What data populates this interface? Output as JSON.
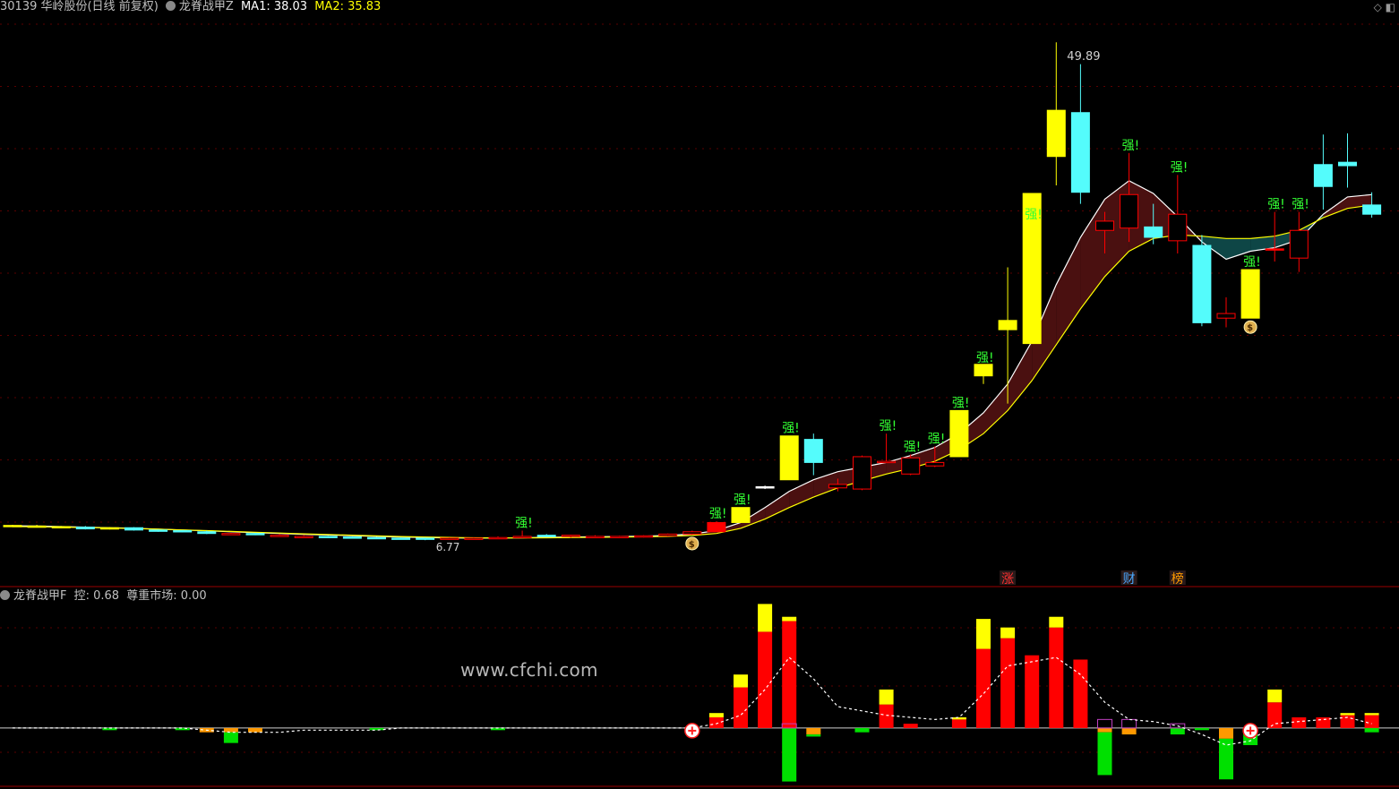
{
  "header": {
    "stock": "30139 华岭股份(日线 前复权)",
    "indicator": "龙脊战甲Z",
    "ma1_label": "MA1: 38.03",
    "ma2_label": "MA2: 35.83"
  },
  "sub_header": {
    "indicator": "龙脊战甲F",
    "ctrl_label": "控: 0.68",
    "respect_label": "尊重市场: 0.00"
  },
  "watermark": "www.cfchi.com",
  "colors": {
    "background": "#000000",
    "yang_yellow": "#ffff00",
    "yin_cyan": "#54fcfc",
    "red": "#ff0000",
    "green": "#00e000",
    "orange": "#ff9900",
    "ribbon_up": "#4a1010",
    "ribbon_down": "#0e4646"
  },
  "chart_data": [
    {
      "type": "candlestick",
      "price_range": [
        5.0,
        52.0
      ],
      "high_label": "49.89",
      "low_label": "6.77",
      "strong_label": "强!",
      "x_index": [
        0,
        1,
        2,
        3,
        4,
        5,
        6,
        7,
        8,
        9,
        10,
        11,
        12,
        13,
        14,
        15,
        16,
        17,
        18,
        19,
        20,
        21,
        22,
        23,
        24,
        25,
        26,
        27,
        28,
        29,
        30,
        31,
        32,
        33,
        34,
        35,
        36,
        37,
        38,
        39,
        40,
        41,
        42,
        43,
        44,
        45,
        46,
        47,
        48,
        49,
        50,
        51,
        52,
        53,
        54,
        55,
        56
      ],
      "candles": [
        {
          "o": 8.0,
          "h": 8.1,
          "l": 7.9,
          "c": 8.05,
          "k": "y"
        },
        {
          "o": 8.0,
          "h": 8.1,
          "l": 7.9,
          "c": 8.0,
          "k": "y"
        },
        {
          "o": 7.95,
          "h": 8.0,
          "l": 7.8,
          "c": 7.9,
          "k": "y"
        },
        {
          "o": 7.9,
          "h": 8.0,
          "l": 7.7,
          "c": 7.75,
          "k": "c"
        },
        {
          "o": 7.75,
          "h": 7.9,
          "l": 7.7,
          "c": 7.85,
          "k": "y"
        },
        {
          "o": 7.85,
          "h": 7.9,
          "l": 7.6,
          "c": 7.65,
          "k": "c"
        },
        {
          "o": 7.65,
          "h": 7.7,
          "l": 7.5,
          "c": 7.6,
          "k": "c"
        },
        {
          "o": 7.6,
          "h": 7.65,
          "l": 7.45,
          "c": 7.5,
          "k": "c"
        },
        {
          "o": 7.5,
          "h": 7.6,
          "l": 7.3,
          "c": 7.35,
          "k": "c"
        },
        {
          "o": 7.3,
          "h": 7.4,
          "l": 7.25,
          "c": 7.35,
          "k": "r"
        },
        {
          "o": 7.35,
          "h": 7.4,
          "l": 7.2,
          "c": 7.25,
          "k": "c"
        },
        {
          "o": 7.2,
          "h": 7.3,
          "l": 7.1,
          "c": 7.15,
          "k": "r"
        },
        {
          "o": 7.1,
          "h": 7.2,
          "l": 7.05,
          "c": 7.1,
          "k": "r"
        },
        {
          "o": 7.1,
          "h": 7.15,
          "l": 7.0,
          "c": 7.05,
          "k": "c"
        },
        {
          "o": 7.05,
          "h": 7.1,
          "l": 6.95,
          "c": 7.0,
          "k": "c"
        },
        {
          "o": 7.0,
          "h": 7.05,
          "l": 6.9,
          "c": 6.95,
          "k": "c"
        },
        {
          "o": 6.95,
          "h": 7.0,
          "l": 6.85,
          "c": 6.95,
          "k": "c"
        },
        {
          "o": 6.95,
          "h": 7.0,
          "l": 6.77,
          "c": 6.9,
          "k": "c"
        },
        {
          "o": 6.9,
          "h": 7.0,
          "l": 6.85,
          "c": 6.95,
          "k": "r"
        },
        {
          "o": 6.95,
          "h": 7.0,
          "l": 6.9,
          "c": 6.95,
          "k": "r"
        },
        {
          "o": 6.95,
          "h": 7.1,
          "l": 6.9,
          "c": 7.0,
          "k": "r"
        },
        {
          "o": 7.0,
          "h": 7.6,
          "l": 6.95,
          "c": 7.1,
          "k": "r",
          "strong": true
        },
        {
          "o": 7.1,
          "h": 7.3,
          "l": 7.05,
          "c": 7.2,
          "k": "c"
        },
        {
          "o": 7.2,
          "h": 7.25,
          "l": 7.0,
          "c": 7.1,
          "k": "r"
        },
        {
          "o": 7.1,
          "h": 7.2,
          "l": 7.0,
          "c": 7.05,
          "k": "r"
        },
        {
          "o": 7.05,
          "h": 7.15,
          "l": 7.0,
          "c": 7.1,
          "k": "r"
        },
        {
          "o": 7.1,
          "h": 7.2,
          "l": 7.0,
          "c": 7.15,
          "k": "r"
        },
        {
          "o": 7.15,
          "h": 7.35,
          "l": 7.1,
          "c": 7.3,
          "k": "r"
        },
        {
          "o": 7.3,
          "h": 7.6,
          "l": 7.25,
          "c": 7.5,
          "k": "r"
        },
        {
          "o": 7.5,
          "h": 8.4,
          "l": 7.5,
          "c": 8.3,
          "k": "R",
          "strong": true
        },
        {
          "o": 8.3,
          "h": 9.6,
          "l": 8.3,
          "c": 9.6,
          "k": "y",
          "strong": true
        },
        {
          "o": 11.4,
          "h": 11.5,
          "l": 11.2,
          "c": 11.4,
          "k": "w"
        },
        {
          "o": 12.0,
          "h": 15.8,
          "l": 12.0,
          "c": 15.8,
          "k": "y",
          "strong": true
        },
        {
          "o": 15.5,
          "h": 16.0,
          "l": 12.4,
          "c": 13.5,
          "k": "c"
        },
        {
          "o": 11.3,
          "h": 12.1,
          "l": 11.0,
          "c": 11.6,
          "k": "r"
        },
        {
          "o": 11.2,
          "h": 14.1,
          "l": 11.1,
          "c": 14.0,
          "k": "r"
        },
        {
          "o": 13.5,
          "h": 16.0,
          "l": 13.5,
          "c": 13.6,
          "k": "r",
          "strong": true
        },
        {
          "o": 12.5,
          "h": 14.2,
          "l": 12.4,
          "c": 13.9,
          "k": "r",
          "strong": true
        },
        {
          "o": 13.5,
          "h": 14.9,
          "l": 13.1,
          "c": 13.2,
          "k": "r",
          "strong": true
        },
        {
          "o": 14.0,
          "h": 18.0,
          "l": 14.0,
          "c": 18.0,
          "k": "y",
          "strong": true
        },
        {
          "o": 21.0,
          "h": 21.9,
          "l": 20.3,
          "c": 22.0,
          "k": "y",
          "strong": true
        },
        {
          "o": 25.0,
          "h": 30.4,
          "l": 18.6,
          "c": 25.8,
          "k": "y"
        },
        {
          "o": 23.8,
          "h": 34.3,
          "l": 23.8,
          "c": 36.8,
          "k": "y",
          "strong": true
        },
        {
          "o": 40.0,
          "h": 49.89,
          "l": 37.5,
          "c": 44.0,
          "k": "y"
        },
        {
          "o": 43.8,
          "h": 48.0,
          "l": 35.9,
          "c": 36.9,
          "k": "c"
        },
        {
          "o": 33.6,
          "h": 35.2,
          "l": 31.6,
          "c": 34.4,
          "k": "r"
        },
        {
          "o": 33.8,
          "h": 40.3,
          "l": 32.6,
          "c": 36.7,
          "k": "r",
          "strong": true
        },
        {
          "o": 33.9,
          "h": 35.9,
          "l": 32.4,
          "c": 33.0,
          "k": "c"
        },
        {
          "o": 32.7,
          "h": 38.4,
          "l": 31.6,
          "c": 35.0,
          "k": "r",
          "strong": true
        },
        {
          "o": 32.3,
          "h": 33.2,
          "l": 25.3,
          "c": 25.6,
          "k": "c"
        },
        {
          "o": 26.0,
          "h": 27.8,
          "l": 25.2,
          "c": 26.4,
          "k": "r"
        },
        {
          "o": 26.0,
          "h": 30.2,
          "l": 26.0,
          "c": 30.2,
          "k": "y",
          "strong": true
        },
        {
          "o": 32.0,
          "h": 35.2,
          "l": 30.9,
          "c": 32.0,
          "k": "R",
          "strong": true
        },
        {
          "o": 31.2,
          "h": 35.2,
          "l": 30.0,
          "c": 33.6,
          "k": "r",
          "strong": true
        },
        {
          "o": 37.4,
          "h": 41.9,
          "l": 35.4,
          "c": 39.3,
          "k": "c"
        },
        {
          "o": 39.5,
          "h": 42.0,
          "l": 37.3,
          "c": 39.2,
          "k": "c"
        },
        {
          "o": 35.8,
          "h": 36.9,
          "l": 34.7,
          "c": 35.0,
          "k": "c"
        }
      ],
      "ma1": [
        8.02,
        8.0,
        7.95,
        7.9,
        7.85,
        7.8,
        7.72,
        7.65,
        7.58,
        7.5,
        7.42,
        7.35,
        7.28,
        7.22,
        7.16,
        7.1,
        7.05,
        7.0,
        6.97,
        6.95,
        6.96,
        6.98,
        7.02,
        7.05,
        7.07,
        7.09,
        7.12,
        7.18,
        7.3,
        7.6,
        8.3,
        9.6,
        11.0,
        12.0,
        12.7,
        13.1,
        13.5,
        14.1,
        14.8,
        16.0,
        17.8,
        20.3,
        24.0,
        28.9,
        33.0,
        36.3,
        37.9,
        36.8,
        34.8,
        32.6,
        31.1,
        31.8,
        32.1,
        32.8,
        35.0,
        36.5,
        36.7
      ],
      "ma2": [
        7.95,
        7.93,
        7.9,
        7.87,
        7.83,
        7.78,
        7.72,
        7.66,
        7.6,
        7.53,
        7.46,
        7.39,
        7.32,
        7.26,
        7.2,
        7.14,
        7.09,
        7.05,
        7.01,
        6.98,
        6.97,
        6.97,
        6.98,
        7.0,
        7.02,
        7.04,
        7.06,
        7.1,
        7.18,
        7.35,
        7.8,
        8.6,
        9.6,
        10.5,
        11.3,
        11.9,
        12.5,
        13.0,
        13.6,
        14.6,
        16.0,
        18.0,
        20.6,
        23.7,
        26.8,
        29.6,
        31.8,
        32.9,
        33.2,
        33.1,
        32.9,
        32.9,
        33.1,
        33.6,
        34.7,
        35.5,
        35.8
      ],
      "dollar_markers": [
        28,
        51
      ],
      "tags": [
        {
          "index": 41,
          "text": "涨",
          "color": "#ff3030"
        },
        {
          "index": 46,
          "text": "财",
          "color": "#4aa8ff"
        },
        {
          "index": 48,
          "text": "榜",
          "color": "#ff9900"
        }
      ]
    },
    {
      "type": "bar",
      "baseline": 0,
      "value_range": [
        -2.6,
        5.9
      ],
      "x_index": [
        0,
        1,
        2,
        3,
        4,
        5,
        6,
        7,
        8,
        9,
        10,
        11,
        12,
        13,
        14,
        15,
        16,
        17,
        18,
        19,
        20,
        21,
        22,
        23,
        24,
        25,
        26,
        27,
        28,
        29,
        30,
        31,
        32,
        33,
        34,
        35,
        36,
        37,
        38,
        39,
        40,
        41,
        42,
        43,
        44,
        45,
        46,
        47,
        48,
        49,
        50,
        51,
        52,
        53,
        54,
        55,
        56
      ],
      "red": [
        0,
        0,
        0,
        0,
        0,
        0,
        0,
        0,
        0,
        0,
        0,
        0,
        0,
        0,
        0,
        0,
        0,
        0,
        0,
        0,
        0,
        0,
        0,
        0,
        0,
        0,
        0,
        0,
        0,
        0.5,
        1.9,
        4.5,
        5.0,
        0,
        0,
        0,
        1.1,
        0.2,
        0,
        0.4,
        3.7,
        4.2,
        3.4,
        4.7,
        3.2,
        0,
        0,
        0,
        0,
        0,
        0,
        0,
        1.2,
        0.5,
        0.5,
        0.6,
        0.6
      ],
      "yellow": [
        0,
        0,
        0,
        0,
        0,
        0,
        0,
        0,
        0,
        0,
        0,
        0,
        0,
        0,
        0,
        0,
        0,
        0,
        0,
        0,
        0,
        0,
        0,
        0,
        0,
        0,
        0,
        0,
        0,
        0.2,
        0.6,
        1.3,
        0.2,
        0,
        0,
        0,
        0.7,
        0,
        0,
        0.1,
        1.4,
        0.5,
        0,
        0.5,
        0,
        0,
        0,
        0,
        0,
        0,
        0,
        0,
        0.6,
        0,
        0,
        0.1,
        0.1
      ],
      "green": [
        0,
        0,
        0,
        0,
        -0.1,
        0,
        0,
        -0.1,
        0,
        -0.5,
        0,
        0,
        0,
        0,
        0,
        -0.1,
        0,
        0,
        0,
        0,
        -0.1,
        0,
        0,
        0,
        0,
        0,
        0,
        0,
        0,
        0,
        0,
        0,
        -2.5,
        -0.1,
        0,
        -0.2,
        0,
        0,
        0,
        0,
        0,
        0,
        0,
        0,
        0,
        -2.0,
        0,
        0,
        -0.3,
        -0.1,
        -1.9,
        -0.5,
        0,
        0,
        0,
        0,
        -0.2
      ],
      "orange": [
        0,
        0,
        0,
        0,
        0,
        0,
        0,
        0,
        -0.2,
        -0.2,
        -0.2,
        0,
        0,
        0,
        0,
        0,
        0,
        0,
        0,
        0,
        0,
        0,
        0,
        0,
        0,
        0,
        0,
        0,
        0,
        0,
        0,
        0,
        0,
        -0.3,
        0,
        0,
        0,
        0,
        0,
        0,
        0,
        0,
        0,
        0,
        0,
        -0.2,
        -0.3,
        0,
        0,
        0,
        -0.5,
        -0.3,
        0,
        0,
        0,
        0,
        0
      ],
      "hollow": [
        0,
        0,
        0,
        0,
        0,
        0,
        0,
        0,
        0,
        0,
        0,
        0,
        0,
        0,
        0,
        0,
        0,
        0,
        0,
        0,
        0,
        0,
        0,
        0,
        0,
        0,
        0,
        0,
        0,
        0,
        0,
        0,
        0.2,
        0,
        0,
        0,
        0,
        0,
        0,
        0,
        0,
        0,
        0,
        0,
        0,
        0.4,
        0.4,
        0,
        0.2,
        0,
        0,
        0,
        0,
        0,
        0,
        0,
        0
      ],
      "dashed_line": [
        0,
        0,
        0,
        0,
        0,
        0,
        0,
        0,
        -0.1,
        -0.2,
        -0.2,
        -0.2,
        -0.1,
        -0.1,
        -0.1,
        -0.1,
        0,
        0,
        0,
        0,
        0,
        0,
        0,
        0,
        0,
        0,
        0,
        0,
        0,
        0.2,
        0.6,
        1.8,
        3.3,
        2.3,
        1.0,
        0.8,
        0.6,
        0.5,
        0.4,
        0.5,
        1.6,
        2.9,
        3.1,
        3.3,
        2.5,
        1.2,
        0.4,
        0.3,
        0.1,
        -0.3,
        -0.8,
        -0.6,
        0.2,
        0.3,
        0.4,
        0.5,
        0.2
      ],
      "plus_markers": [
        28,
        51
      ]
    }
  ]
}
